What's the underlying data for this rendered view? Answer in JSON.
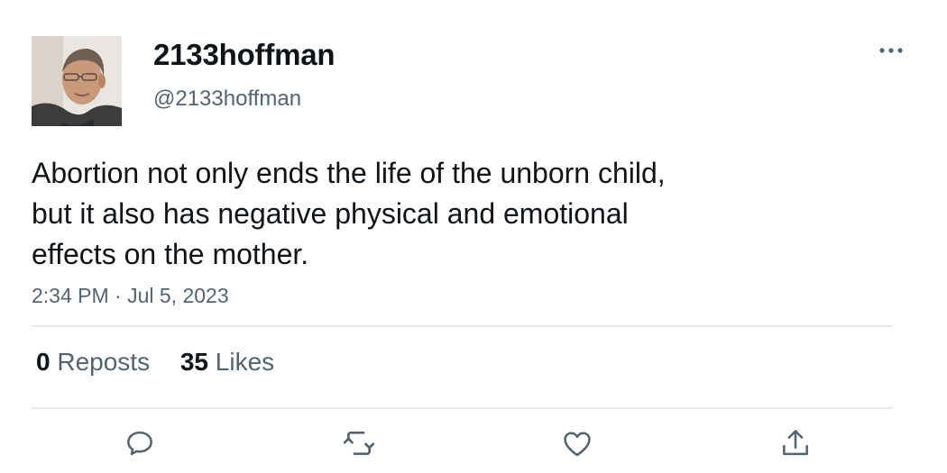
{
  "user": {
    "display_name": "2133hoffman",
    "handle": "@2133hoffman"
  },
  "tweet": {
    "text_lines": [
      "Abortion not only ends the life of the unborn child,",
      "but it also has negative physical and emotional",
      "effects on the mother."
    ],
    "timestamp": "2:34 PM · Jul 5, 2023"
  },
  "stats": {
    "reposts": {
      "count": "0",
      "label": "Reposts"
    },
    "likes": {
      "count": "35",
      "label": "Likes"
    }
  },
  "icons": {
    "more": "more-horizontal-icon",
    "reply": "reply-icon",
    "repost": "repost-icon",
    "like": "heart-icon",
    "share": "share-icon"
  },
  "colors": {
    "text_primary": "#0f1419",
    "text_secondary": "#536471",
    "divider": "#e7e9ec"
  }
}
